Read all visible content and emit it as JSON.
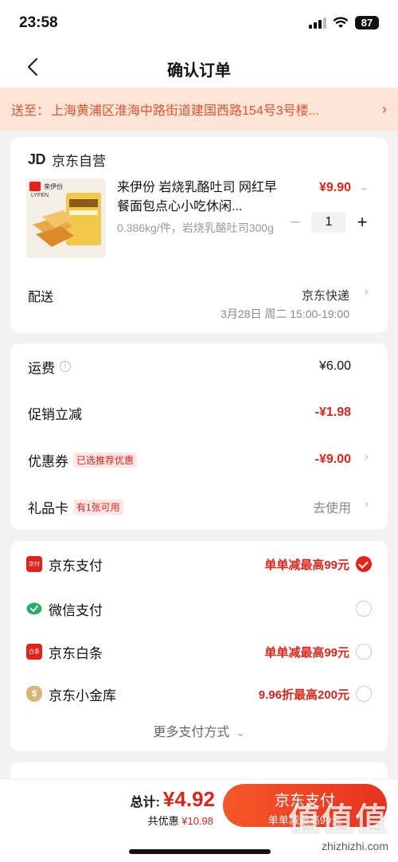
{
  "status_bar": {
    "time": "23:58",
    "battery": "87"
  },
  "nav": {
    "title": "确认订单"
  },
  "address": {
    "prefix": "送至：",
    "text": "上海黄浦区淮海中路街道建国西路154号3号楼..."
  },
  "shop": {
    "logo": "JD",
    "name": "京东自营"
  },
  "product": {
    "title": "来伊份 岩烧乳酪吐司 网红早餐面包点心小吃休闲...",
    "spec": "0.386kg/件，岩烧乳酪吐司300g",
    "price": "¥9.90",
    "quantity": "1",
    "img_brand": "来伊份",
    "img_brand_en": "LYFEN"
  },
  "delivery": {
    "label": "配送",
    "method": "京东快递",
    "time": "3月28日 周二 15:00-19:00"
  },
  "fees": [
    {
      "label": "运费",
      "tag": "",
      "value": "¥6.00",
      "style": "black",
      "info": true,
      "chevron": false
    },
    {
      "label": "促销立减",
      "tag": "",
      "value": "-¥1.98",
      "style": "red",
      "info": false,
      "chevron": false
    },
    {
      "label": "优惠券",
      "tag": "已选推荐优惠",
      "value": "-¥9.00",
      "style": "red",
      "info": false,
      "chevron": true
    },
    {
      "label": "礼品卡",
      "tag": "有1张可用",
      "value": "去使用",
      "style": "gray",
      "info": false,
      "chevron": true
    }
  ],
  "payments": [
    {
      "name": "京东支付",
      "promo": "单单减最高99元",
      "checked": true,
      "icon": "jd-pay-icon",
      "icon_color": "#e2231a",
      "icon_text": "京付"
    },
    {
      "name": "微信支付",
      "promo": "",
      "checked": false,
      "icon": "wechat-pay-icon",
      "icon_color": "#2aae67",
      "icon_text": ""
    },
    {
      "name": "京东白条",
      "promo": "单单减最高99元",
      "checked": false,
      "icon": "baitiao-icon",
      "icon_color": "#e2231a",
      "icon_text": "白条"
    },
    {
      "name": "京东小金库",
      "promo": "9.96折最高200元",
      "checked": false,
      "icon": "money-bag-icon",
      "icon_color": "#c9a46a",
      "icon_text": "$"
    }
  ],
  "more_payments": "更多支付方式",
  "bottom": {
    "total_label": "总计:",
    "total_amount": "¥4.92",
    "discount_label": "共优惠",
    "discount_amount": "¥10.98",
    "pay_button": "京东支付",
    "pay_button_sub": "单单减最高99元"
  },
  "watermark": {
    "logo": "值值值",
    "url": "zhizhizhi.com"
  },
  "colors": {
    "accent": "#e2231a",
    "address_bg": "#fde4d6",
    "address_text": "#e0552e"
  }
}
